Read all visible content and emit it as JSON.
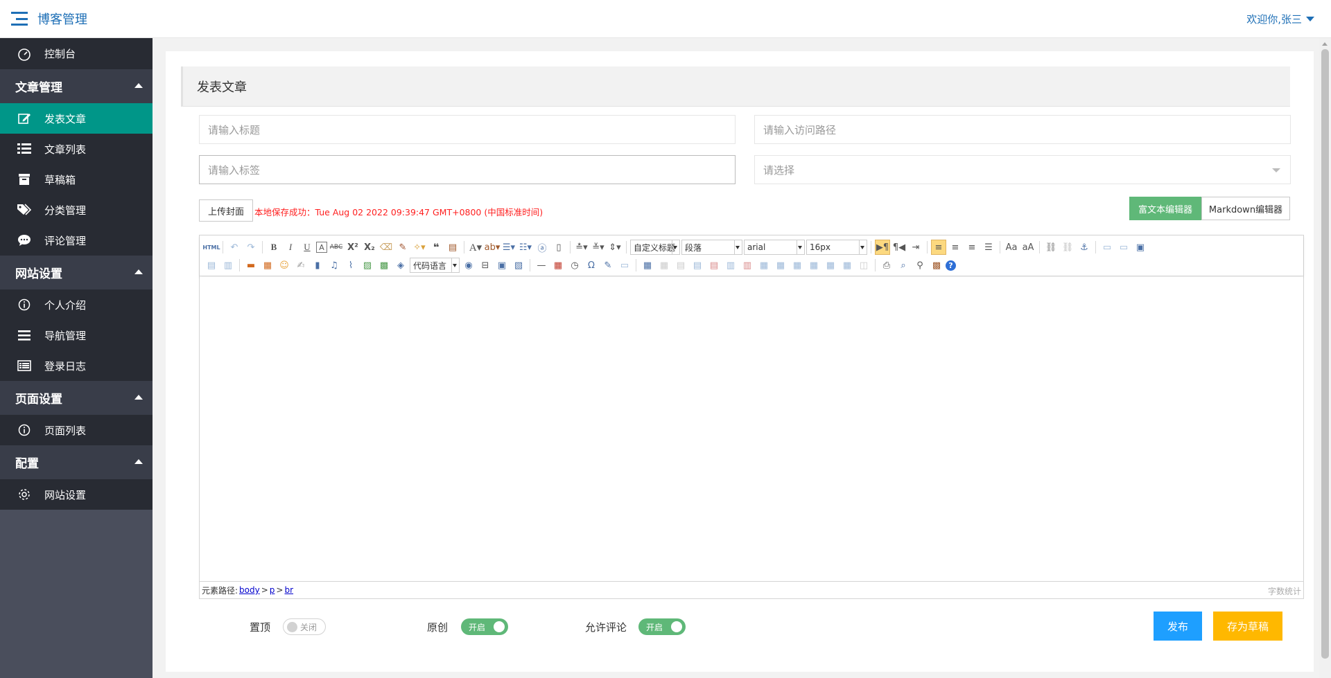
{
  "header": {
    "brand": "博客管理",
    "welcome": "欢迎你,张三"
  },
  "sidebar": {
    "dashboard": "控制台",
    "groups": [
      {
        "title": "文章管理",
        "items": [
          "发表文章",
          "文章列表",
          "草稿箱",
          "分类管理",
          "评论管理"
        ]
      },
      {
        "title": "网站设置",
        "items": [
          "个人介绍",
          "导航管理",
          "登录日志"
        ]
      },
      {
        "title": "页面设置",
        "items": [
          "页面列表"
        ]
      },
      {
        "title": "配置",
        "items": [
          "网站设置"
        ]
      }
    ]
  },
  "page": {
    "title": "发表文章",
    "title_placeholder": "请输入标题",
    "path_placeholder": "请输入访问路径",
    "tag_placeholder": "请输入标签",
    "category_placeholder": "请选择",
    "upload_cover": "上传封面",
    "save_message": "本地保存成功：Tue Aug 02 2022 09:39:47 GMT+0800 (中国标准时间)",
    "rich_editor": "富文本编辑器",
    "markdown_editor": "Markdown编辑器"
  },
  "editor": {
    "html_label": "HTML",
    "selects": {
      "custom_title": "自定义标题",
      "paragraph": "段落",
      "font": "arial",
      "size": "16px",
      "code_lang": "代码语言"
    },
    "path_label": "元素路径:",
    "path": [
      "body",
      "p",
      "br"
    ],
    "path_sep": ">",
    "word_count": "字数统计"
  },
  "bottom": {
    "top_label": "置顶",
    "top_switch": "关闭",
    "original_label": "原创",
    "original_switch": "开启",
    "comment_label": "允许评论",
    "comment_switch": "开启",
    "publish": "发布",
    "save_draft": "存为草稿"
  },
  "colors": {
    "accent_blue": "#1e6fb6",
    "active_green": "#009688",
    "switch_green": "#5fb878",
    "publish_blue": "#1e9fff",
    "draft_orange": "#ffb800"
  }
}
